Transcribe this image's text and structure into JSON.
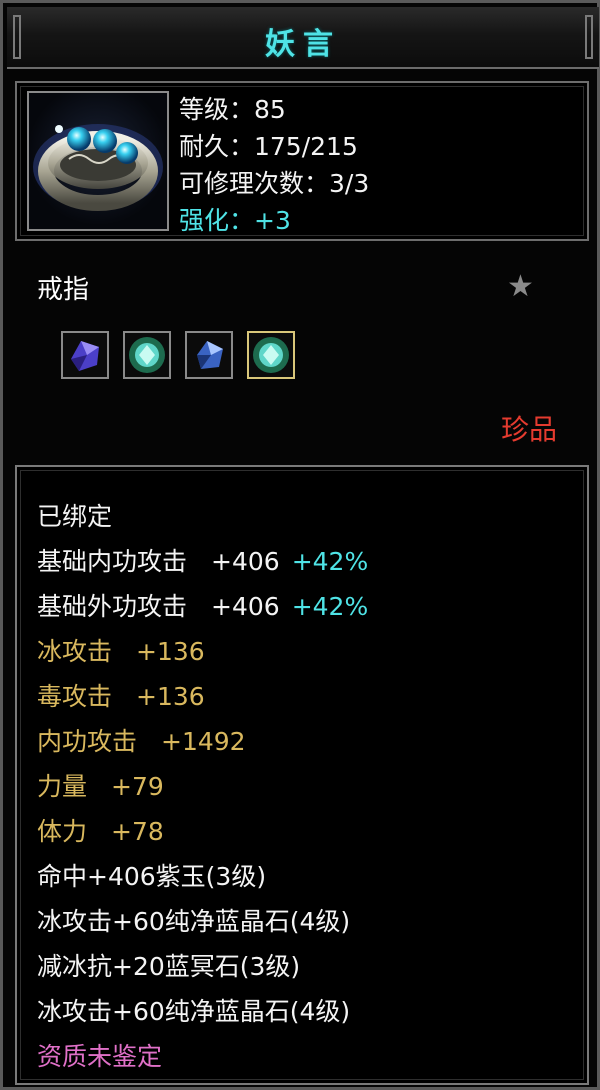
{
  "title": "妖言",
  "stats": {
    "level": "等级：85",
    "durability": "耐久：175/215",
    "repairs": "可修理次数：3/3",
    "enhance": "强化：+3"
  },
  "item_type": "戒指",
  "rarity": "珍品",
  "gems": [
    "purple-gem-icon",
    "green-crystal-icon",
    "blue-gem-icon",
    "green-crystal-icon"
  ],
  "details": {
    "bound": "已绑定",
    "base_inner_attack": {
      "label": "基础内功攻击",
      "value": "+406",
      "bonus": "+42%"
    },
    "base_outer_attack": {
      "label": "基础外功攻击",
      "value": "+406",
      "bonus": "+42%"
    },
    "ice_attack": {
      "label": "冰攻击",
      "value": "+136"
    },
    "poison_attack": {
      "label": "毒攻击",
      "value": "+136"
    },
    "inner_attack": {
      "label": "内功攻击",
      "value": "+1492"
    },
    "strength": {
      "label": "力量",
      "value": "+79"
    },
    "stamina": {
      "label": "体力",
      "value": "+78"
    },
    "socket1": "命中+406紫玉(3级)",
    "socket2": "冰攻击+60纯净蓝晶石(4级)",
    "socket3": "减冰抗+20蓝冥石(3级)",
    "socket4": "冰攻击+60纯净蓝晶石(4级)",
    "quality": "资质未鉴定"
  },
  "colors": {
    "cyan": "#4fe3e6",
    "gold": "#d9b85e",
    "red": "#e53b2f",
    "pink": "#e070c8"
  }
}
